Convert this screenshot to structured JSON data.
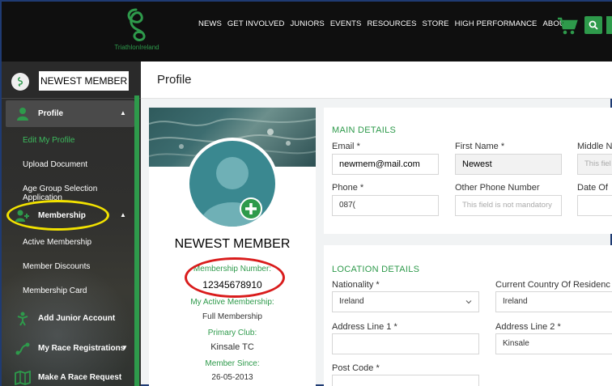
{
  "brand": {
    "logo_text": "TriathlonIreland",
    "accent": "#2e9a4b"
  },
  "nav": {
    "items": [
      "NEWS",
      "GET INVOLVED",
      "JUNIORS",
      "EVENTS",
      "RESOURCES",
      "STORE",
      "HIGH PERFORMANCE",
      "ABOUT"
    ]
  },
  "icons": {
    "cart": "cart-icon",
    "search": "search-icon"
  },
  "sidebar": {
    "user_name": "NEWEST MEMBER",
    "profile": "Profile",
    "edit_profile": "Edit My Profile",
    "upload_document": "Upload Document",
    "age_group": "Age Group Selection Application",
    "membership": "Membership",
    "active_membership": "Active Membership",
    "member_discounts": "Member Discounts",
    "membership_card": "Membership Card",
    "add_junior": "Add Junior Account",
    "race_registrations": "My Race Registrations",
    "race_request": "Make A Race Request"
  },
  "page": {
    "title": "Profile"
  },
  "profile_card": {
    "name": "NEWEST MEMBER",
    "membership_number_label": "Membership Number:",
    "membership_number": "12345678910",
    "active_membership_label": "My Active Membership:",
    "active_membership": "Full Membership",
    "primary_club_label": "Primary Club:",
    "primary_club": "Kinsale TC",
    "member_since_label": "Member Since:",
    "member_since": "26-05-2013"
  },
  "main_details": {
    "title": "MAIN DETAILS",
    "email_label": "Email",
    "email_value": "newmem@mail.com",
    "first_name_label": "First Name",
    "first_name_value": "Newest",
    "middle_name_label": "Middle N",
    "middle_name_placeholder": "This fiel",
    "phone_label": "Phone",
    "phone_value": "087(",
    "other_phone_label": "Other Phone Number",
    "other_phone_placeholder": "This field is not mandatory",
    "dob_label": "Date Of",
    "required_mark": "*"
  },
  "location_details": {
    "title": "LOCATION DETAILS",
    "nationality_label": "Nationality",
    "nationality_value": "Ireland",
    "country_label": "Current Country Of Residenc",
    "country_value": "Ireland",
    "address1_label": "Address Line 1",
    "address2_label": "Address Line 2",
    "address2_value": "Kinsale",
    "postcode_label": "Post Code",
    "required_mark": "*"
  }
}
